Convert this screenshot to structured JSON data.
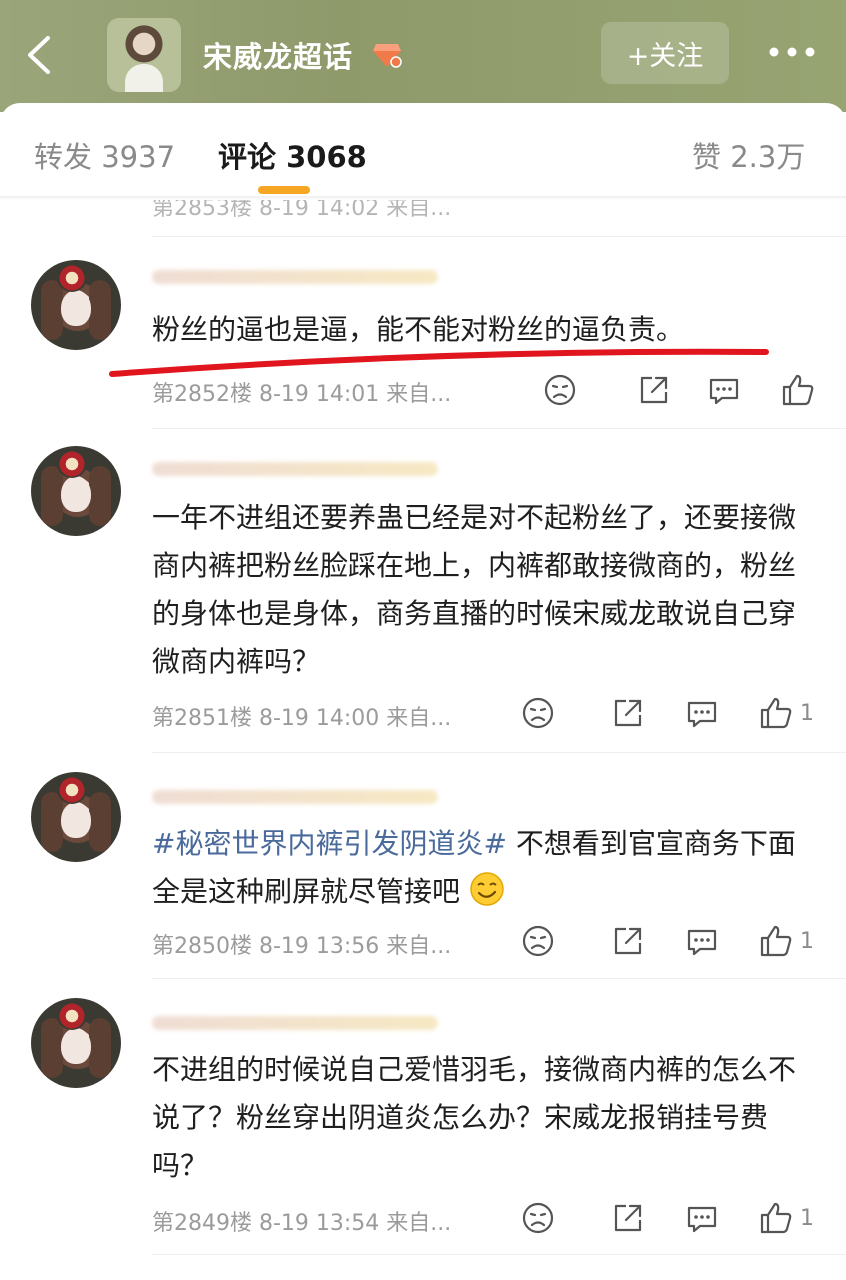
{
  "header": {
    "title": "宋威龙超话",
    "follow_label": "+关注",
    "accent_color": "#f5a623",
    "icons": [
      "back-arrow-icon",
      "level-badge-icon",
      "more-dots-icon"
    ]
  },
  "tabs": [
    {
      "label": "转发 3937",
      "active": false
    },
    {
      "label": "评论 3068",
      "active": true
    },
    {
      "label": "赞 2.3万",
      "active": false
    }
  ],
  "previous_meta": "第2853楼 8-19 14:02 来自...",
  "comments": [
    {
      "text": "粉丝的逼也是逼，能不能对粉丝的逼负责。",
      "meta": "第2852楼 8-19 14:01 来自...",
      "likes": ""
    },
    {
      "text": "一年不进组还要养蛊已经是对不起粉丝了，还要接微商内裤把粉丝脸踩在地上，内裤都敢接微商的，粉丝的身体也是身体，商务直播的时候宋威龙敢说自己穿微商内裤吗？",
      "meta": "第2851楼 8-19 14:00 来自...",
      "likes": "1"
    },
    {
      "hashtag": "#秘密世界内裤引发阴道炎#",
      "text": " 不想看到官宣商务下面全是这种刷屏就尽管接吧",
      "meta": "第2850楼 8-19 13:56 来自...",
      "likes": "1"
    },
    {
      "text": "不进组的时候说自己爱惜羽毛，接微商内裤的怎么不说了？粉丝穿出阴道炎怎么办？宋威龙报销挂号费吗？",
      "meta": "第2849楼 8-19 13:54 来自...",
      "likes": "1"
    }
  ]
}
